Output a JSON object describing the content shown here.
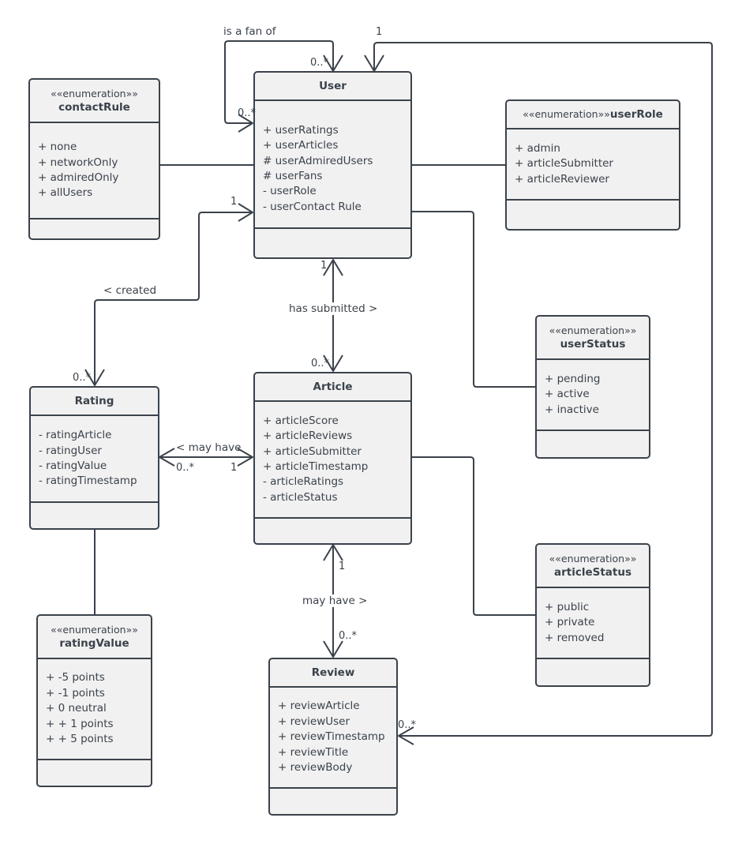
{
  "diagram": {
    "type": "UML class diagram",
    "classes": {
      "user": {
        "name": "User",
        "attributes": [
          "+ userRatings",
          "+ userArticles",
          "# userAdmiredUsers",
          "# userFans",
          "- userRole",
          "- userContact Rule"
        ]
      },
      "article": {
        "name": "Article",
        "attributes": [
          "+ articleScore",
          "+ articleReviews",
          "+ articleSubmitter",
          "+ articleTimestamp",
          "- articleRatings",
          "- articleStatus"
        ]
      },
      "rating": {
        "name": "Rating",
        "attributes": [
          "- ratingArticle",
          "- ratingUser",
          "- ratingValue",
          "- ratingTimestamp"
        ]
      },
      "review": {
        "name": "Review",
        "attributes": [
          "+ reviewArticle",
          "+ reviewUser",
          "+ reviewTimestamp",
          "+ reviewTitle",
          "+ reviewBody"
        ]
      }
    },
    "enumerations": {
      "contactRule": {
        "stereotype": "««enumeration»»",
        "name": "contactRule",
        "values": [
          "+ none",
          "+ networkOnly",
          "+ admiredOnly",
          "+ allUsers"
        ]
      },
      "userRole": {
        "stereotype": "««enumeration»»",
        "name": "userRole",
        "values": [
          "+ admin",
          "+ articleSubmitter",
          "+ articleReviewer"
        ]
      },
      "userStatus": {
        "stereotype": "««enumeration»»",
        "name": "userStatus",
        "values": [
          "+ pending",
          "+ active",
          "+ inactive"
        ]
      },
      "articleStatus": {
        "stereotype": "««enumeration»»",
        "name": "articleStatus",
        "values": [
          "+ public",
          "+ private",
          "+ removed"
        ]
      },
      "ratingValue": {
        "stereotype": "««enumeration»»",
        "name": "ratingValue",
        "values": [
          "+ -5 points",
          "+ -1 points",
          "+ 0 neutral",
          "+ + 1 points",
          "+ + 5 points"
        ]
      }
    },
    "associations": {
      "fan": {
        "label": "is a fan of",
        "mult_top": "0..*",
        "mult_left": "0..*"
      },
      "review_user": {
        "mult_user": "1",
        "mult_review": "0..*"
      },
      "created": {
        "label": "< created",
        "mult_user": "1",
        "mult_rating": "0..*"
      },
      "submitted": {
        "label": "has submitted >",
        "mult_user": "1",
        "mult_article": "0..*"
      },
      "article_rating": {
        "label": "< may have",
        "mult_rating": "0..*",
        "mult_article": "1"
      },
      "article_review": {
        "label": "may have >",
        "mult_article": "1",
        "mult_review": "0..*"
      }
    }
  }
}
